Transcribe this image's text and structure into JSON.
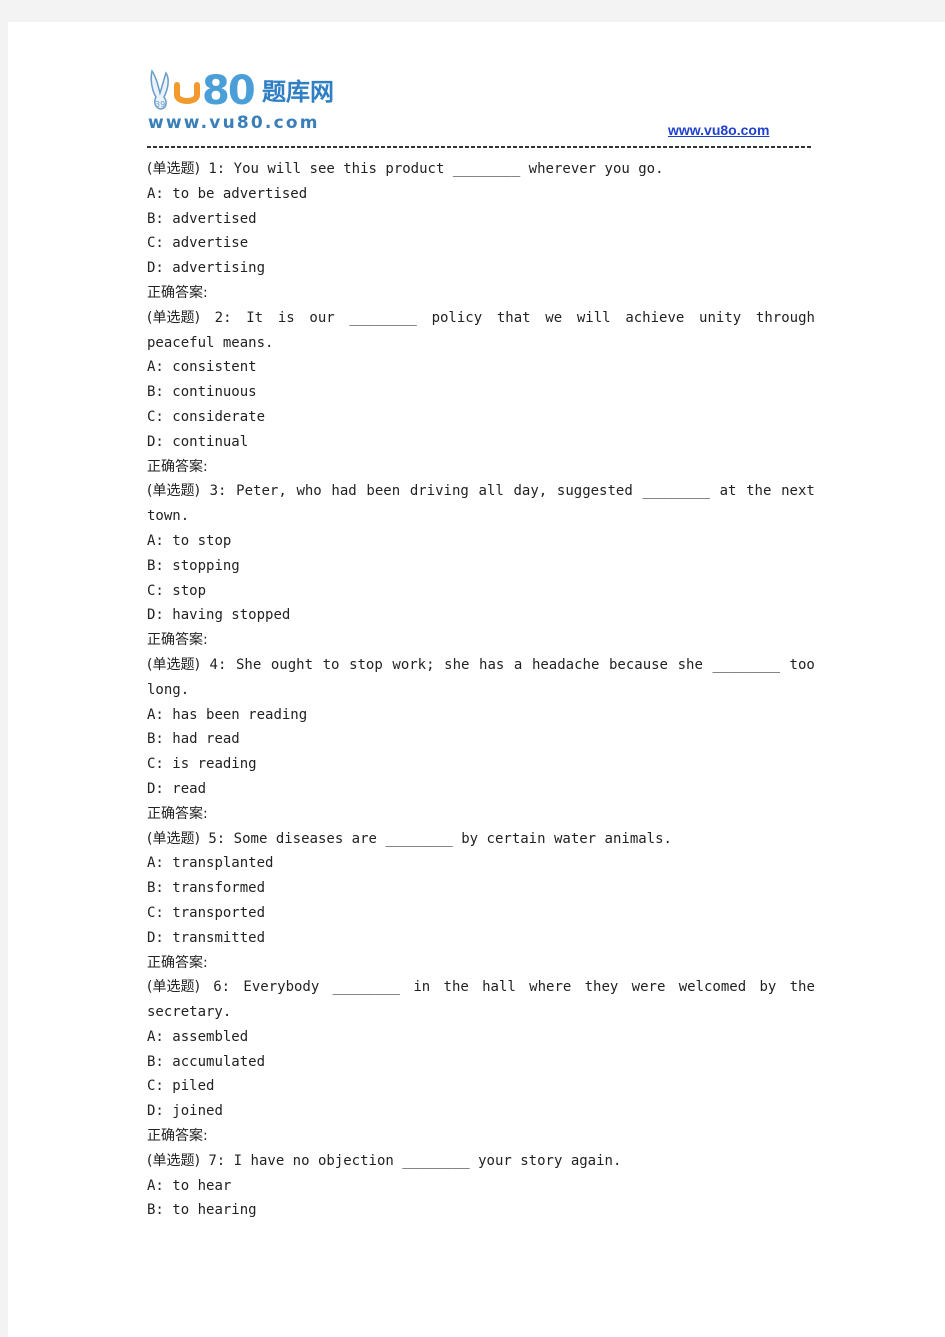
{
  "header": {
    "logo_text_brand": "u80",
    "logo_text_cn": "题库网",
    "logo_url_text": "www.vu80.com",
    "site_link": "www.vu8o.com"
  },
  "labels": {
    "question_type": "(单选题)",
    "correct_answer": "正确答案:"
  },
  "questions": [
    {
      "number": "1:",
      "stem_lines": [
        [
          "You will see this product ________ wherever you go."
        ]
      ],
      "options": [
        {
          "key": "A:",
          "text": "to be advertised"
        },
        {
          "key": "B:",
          "text": "advertised"
        },
        {
          "key": "C:",
          "text": "advertise"
        },
        {
          "key": "D:",
          "text": "advertising"
        }
      ]
    },
    {
      "number": "2:",
      "stem_lines": [
        [
          "It",
          "is",
          "our",
          "________",
          "policy",
          "that",
          "we",
          "will",
          "achieve",
          "unity",
          "through"
        ],
        [
          "peaceful means."
        ]
      ],
      "options": [
        {
          "key": "A:",
          "text": "consistent"
        },
        {
          "key": "B:",
          "text": "continuous"
        },
        {
          "key": "C:",
          "text": "considerate"
        },
        {
          "key": "D:",
          "text": "continual"
        }
      ]
    },
    {
      "number": "3:",
      "stem_lines": [
        [
          "Peter,",
          "who",
          "had",
          "been",
          "driving",
          "all",
          "day,",
          "suggested",
          "________",
          "at",
          "the",
          "next"
        ],
        [
          "town."
        ]
      ],
      "options": [
        {
          "key": "A:",
          "text": "to stop"
        },
        {
          "key": "B:",
          "text": "stopping"
        },
        {
          "key": "C:",
          "text": "stop"
        },
        {
          "key": "D:",
          "text": "having stopped"
        }
      ]
    },
    {
      "number": "4:",
      "stem_lines": [
        [
          "She",
          "ought",
          "to",
          "stop",
          "work;",
          "she",
          "has",
          "a",
          "headache",
          "because",
          "she",
          "________",
          "too"
        ],
        [
          "long."
        ]
      ],
      "options": [
        {
          "key": "A:",
          "text": "has been reading"
        },
        {
          "key": "B:",
          "text": "had read"
        },
        {
          "key": "C:",
          "text": "is reading"
        },
        {
          "key": "D:",
          "text": "read"
        }
      ]
    },
    {
      "number": "5:",
      "stem_lines": [
        [
          "Some diseases are ________ by certain water animals."
        ]
      ],
      "options": [
        {
          "key": "A:",
          "text": "transplanted"
        },
        {
          "key": "B:",
          "text": "transformed"
        },
        {
          "key": "C:",
          "text": "transported"
        },
        {
          "key": "D:",
          "text": "transmitted"
        }
      ]
    },
    {
      "number": "6:",
      "stem_lines": [
        [
          "Everybody",
          "________",
          "in",
          "the",
          "hall",
          "where",
          "they",
          "were",
          "welcomed",
          "by",
          "the"
        ],
        [
          "secretary."
        ]
      ],
      "options": [
        {
          "key": "A:",
          "text": "assembled"
        },
        {
          "key": "B:",
          "text": "accumulated"
        },
        {
          "key": "C:",
          "text": "piled"
        },
        {
          "key": "D:",
          "text": "joined"
        }
      ]
    },
    {
      "number": "7:",
      "stem_lines": [
        [
          "I have no objection ________ your story again."
        ]
      ],
      "options": [
        {
          "key": "A:",
          "text": "to hear"
        },
        {
          "key": "B:",
          "text": "to hearing"
        }
      ],
      "truncated": true
    }
  ]
}
